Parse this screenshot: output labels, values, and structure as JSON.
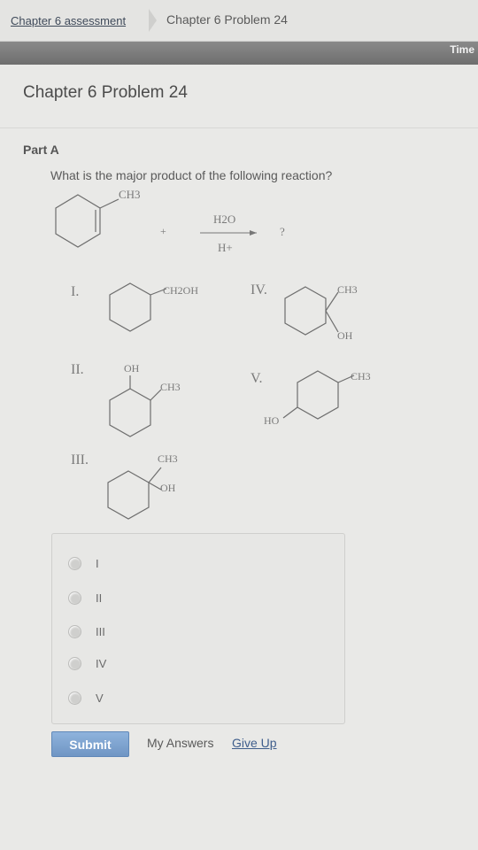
{
  "breadcrumb": {
    "parent": "Chapter 6 assessment",
    "current": "Chapter 6 Problem 24"
  },
  "topbar": {
    "timer_label": "Time"
  },
  "page": {
    "title": "Chapter 6 Problem 24",
    "part": "Part A",
    "question": "What is the major product of the following reaction?"
  },
  "reaction": {
    "substituent": "CH3",
    "plus": "+",
    "reagent_top": "H2O",
    "reagent_bottom": "H+",
    "product": "?"
  },
  "structures": [
    {
      "numeral": "I.",
      "labels": [
        "CH2OH"
      ]
    },
    {
      "numeral": "II.",
      "labels": [
        "OH",
        "CH3"
      ]
    },
    {
      "numeral": "III.",
      "labels": [
        "CH3",
        "OH"
      ]
    },
    {
      "numeral": "IV.",
      "labels": [
        "CH3",
        "OH"
      ]
    },
    {
      "numeral": "V.",
      "labels": [
        "CH3",
        "HO"
      ]
    }
  ],
  "options": [
    "I",
    "II",
    "III",
    "IV",
    "V"
  ],
  "footer": {
    "submit": "Submit",
    "my_answers": "My Answers",
    "give_up": "Give Up"
  }
}
